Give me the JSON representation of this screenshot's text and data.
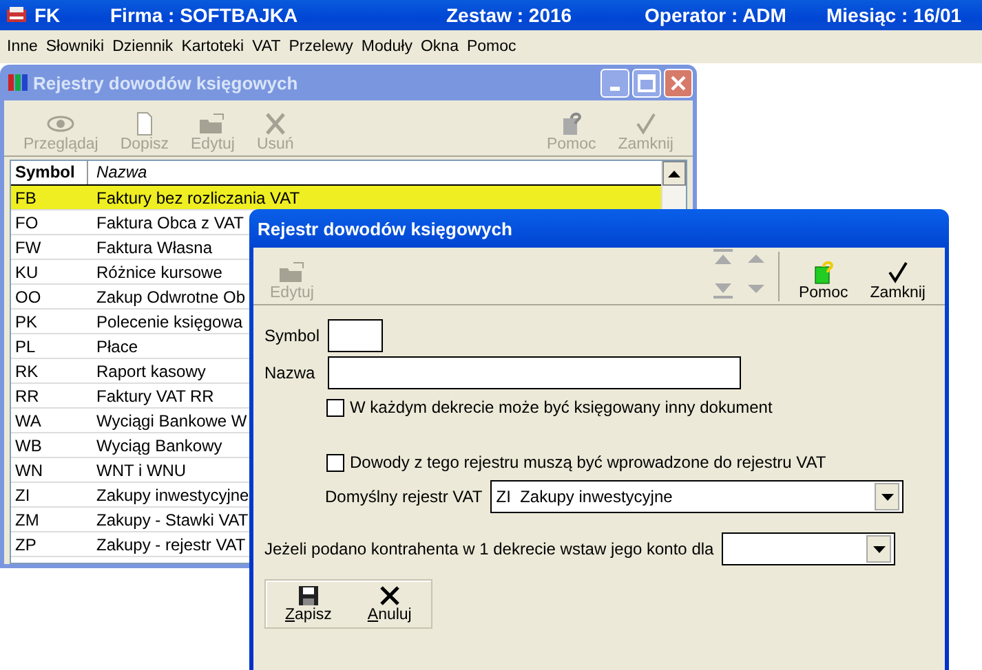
{
  "app_bar": {
    "app": "FK",
    "firma": "Firma : SOFTBAJKA",
    "zestaw": "Zestaw : 2016",
    "operator": "Operator : ADM",
    "miesiac": "Miesiąc : 16/01"
  },
  "menu": [
    "Inne",
    "Słowniki",
    "Dziennik",
    "Kartoteki",
    "VAT",
    "Przelewy",
    "Moduły",
    "Okna",
    "Pomoc"
  ],
  "list_window": {
    "title": "Rejestry dowodów księgowych",
    "active": false,
    "toolbar_left": [
      {
        "label": "Przeglądaj",
        "kind": "view",
        "disabled": true
      },
      {
        "label": "Dopisz",
        "kind": "new",
        "disabled": true
      },
      {
        "label": "Edytuj",
        "kind": "edit",
        "disabled": true
      },
      {
        "label": "Usuń",
        "kind": "delete",
        "disabled": true
      }
    ],
    "toolbar_right": [
      {
        "label": "Pomoc",
        "kind": "help",
        "disabled": true
      },
      {
        "label": "Zamknij",
        "kind": "close",
        "disabled": true
      }
    ],
    "table": {
      "columns": [
        "Symbol",
        "Nazwa"
      ],
      "rows": [
        {
          "symbol": "FB",
          "name": "Faktury bez rozliczania VAT",
          "selected": true
        },
        {
          "symbol": "FO",
          "name": "Faktura Obca z VAT",
          "selected": false
        },
        {
          "symbol": "FW",
          "name": "Faktura Własna",
          "selected": false
        },
        {
          "symbol": "KU",
          "name": "Różnice kursowe",
          "selected": false
        },
        {
          "symbol": "OO",
          "name": "Zakup Odwrotne Ob",
          "selected": false
        },
        {
          "symbol": "PK",
          "name": "Polecenie księgowa",
          "selected": false
        },
        {
          "symbol": "PL",
          "name": "Płace",
          "selected": false
        },
        {
          "symbol": "RK",
          "name": "Raport kasowy",
          "selected": false
        },
        {
          "symbol": "RR",
          "name": "Faktury VAT RR",
          "selected": false
        },
        {
          "symbol": "WA",
          "name": "Wyciągi Bankowe W",
          "selected": false
        },
        {
          "symbol": "WB",
          "name": "Wyciąg Bankowy",
          "selected": false
        },
        {
          "symbol": "WN",
          "name": "WNT i WNU",
          "selected": false
        },
        {
          "symbol": "ZI",
          "name": "Zakupy inwestycyjne",
          "selected": false
        },
        {
          "symbol": "ZM",
          "name": "Zakupy - Stawki VAT",
          "selected": false
        },
        {
          "symbol": "ZP",
          "name": "Zakupy - rejestr VAT",
          "selected": false
        }
      ]
    }
  },
  "dialog": {
    "title": "Rejestr dowodów księgowych",
    "active": true,
    "toolbar_left": [
      {
        "label": "Edytuj",
        "kind": "edit",
        "disabled": true
      }
    ],
    "toolbar_right": [
      {
        "label": "Pomoc",
        "kind": "help",
        "disabled": false
      },
      {
        "label": "Zamknij",
        "kind": "close",
        "disabled": false
      }
    ],
    "symbol_label": "Symbol",
    "name_label": "Nazwa",
    "checkboxes": [
      {
        "label": "W każdym dekrecie może być księgowany inny dokument",
        "checked": false
      },
      {
        "label": "Dowody z tego rejestru muszą być wprowadzone do rejestru VAT",
        "checked": false
      }
    ],
    "vat_register": {
      "label": "Domyślny rejestr VAT",
      "value": "ZI  Zakupy inwestycyjne"
    },
    "contractor": {
      "label": "Jeżeli podano kontrahenta w 1 dekrecie wstaw jego konto dla"
    },
    "buttons": [
      {
        "label": "Zapisz",
        "kind": "save"
      },
      {
        "label": "Anuluj",
        "kind": "cancel"
      }
    ]
  }
}
